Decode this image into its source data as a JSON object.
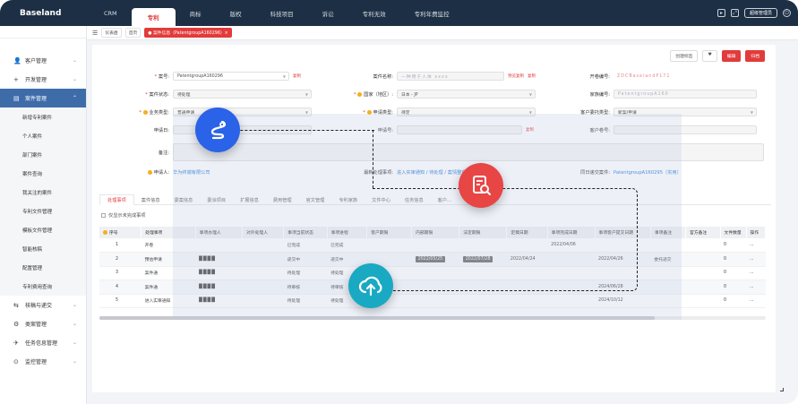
{
  "app": {
    "logo": "Baseland"
  },
  "topnav": {
    "tabs": [
      "CRM",
      "专利",
      "商标",
      "版权",
      "科技项目",
      "诉讼",
      "专利无效",
      "专利年费监控"
    ],
    "active": "专利",
    "user_label": "超级管理员"
  },
  "breadcrumb": {
    "toggle": "☰",
    "items": [
      "仪表盘",
      "首页"
    ],
    "current": "● 案件信息（PatentgroupA160296）×"
  },
  "sidebar": {
    "items": [
      {
        "icon": "👤",
        "label": "客户管理"
      },
      {
        "icon": "+",
        "label": "开发管理"
      },
      {
        "icon": "▤",
        "label": "案件管理"
      }
    ],
    "subitems": [
      "新增专利案件",
      "个人案件",
      "部门案件",
      "案件查询",
      "我关注的案件",
      "专利文件管理",
      "模板文件管理",
      "智能核稿",
      "配置管理",
      "专利费用查询"
    ],
    "bottom_items": [
      {
        "icon": "⇆",
        "label": "核稿与递交"
      },
      {
        "icon": "⚙",
        "label": "类案管理"
      },
      {
        "icon": "✈",
        "label": "任务信息管理"
      },
      {
        "icon": "⊙",
        "label": "监控管理"
      }
    ]
  },
  "actions": {
    "a1": "创建标签",
    "a2": "♥",
    "a3": "编辑",
    "a4": "归档"
  },
  "form": {
    "case_no_label": "案号:",
    "case_no": "PatentgroupA160296",
    "case_no_extra": "复制",
    "case_name_label": "案件名称:",
    "case_name": "一种用于人体 xxxx",
    "case_name_link": "预览复制",
    "case_name_copy": "复制",
    "open_no_label": "开卷编号:",
    "open_no": "ZDCBaselandP171",
    "status_label": "案件状态:",
    "status": "待处理",
    "country_label": "国家（地区）:",
    "country": "日本 - JP",
    "family_no_label": "家族编号:",
    "family_no": "PatentgroupA160",
    "biz_type_label": "业务类型:",
    "biz_type": "普通申请",
    "app_type_label": "申请类型:",
    "app_type": "待定",
    "client_type_label": "客户委托类型:",
    "client_type": "新案/申请",
    "app_date_label": "申请日:",
    "app_no_label": "申请号:",
    "app_no_link": "复制",
    "client_no_label": "客户卷号:",
    "note_label": "备注:",
    "applicant_label": "申请人:",
    "applicant": "华为终端有限公司",
    "latest_label": "最新处理事项:",
    "latest": "进入实审通知 / 待处理 / 案情整理报告",
    "same_case_label": "同日递交案件:",
    "same_case": "PatentgroupA160295（实用）"
  },
  "subtabs": [
    "处理事项",
    "案件信息",
    "委案信息",
    "委派项目",
    "扩展信息",
    "费用管理",
    "官文管理",
    "专利家族",
    "文件中心",
    "任务信息",
    "客户..."
  ],
  "checkbox_label": "仅显示未完成事项",
  "table": {
    "headers": [
      "序号",
      "处理事项",
      "事项办理人",
      "对外处理人",
      "事项当前状态",
      "事项进程",
      "客户期限",
      "内部期限",
      "法定期限",
      "定稿日期",
      "事项完成日期",
      "事项客户提交日期",
      "事项备注",
      "官方备注",
      "文件数量",
      "操作"
    ],
    "rows": [
      {
        "no": "1",
        "item": "开卷",
        "handler": "",
        "ext": "",
        "status": "已完成",
        "progress": "已完成",
        "client_dl": "",
        "internal_dl": "",
        "legal_dl": "",
        "final_date": "",
        "done_date": "2022/04/06",
        "submit_date": "",
        "note": "",
        "official": "",
        "files": "0",
        "op": "..."
      },
      {
        "no": "2",
        "item": "预估申请",
        "handler": "",
        "ext": "",
        "status": "递交中",
        "progress": "递交中",
        "client_dl": "",
        "internal_dl": "2022/05/25",
        "legal_dl": "2022/07/28",
        "final_date": "2022/04/24",
        "done_date": "",
        "submit_date": "2022/04/26",
        "note": "委托递交",
        "official": "",
        "files": "0",
        "op": "..."
      },
      {
        "no": "3",
        "item": "案件通",
        "handler": "",
        "ext": "",
        "status": "待处理",
        "progress": "待处理",
        "client_dl": "",
        "internal_dl": "",
        "legal_dl": "",
        "final_date": "",
        "done_date": "",
        "submit_date": "",
        "note": "",
        "official": "",
        "files": "0",
        "op": "..."
      },
      {
        "no": "4",
        "item": "案件通",
        "handler": "",
        "ext": "",
        "status": "待审核",
        "progress": "待审核",
        "client_dl": "",
        "internal_dl": "",
        "legal_dl": "",
        "final_date": "",
        "done_date": "",
        "submit_date": "2024/06/28",
        "note": "",
        "official": "",
        "files": "0",
        "op": "..."
      },
      {
        "no": "5",
        "item": "进入实审通知",
        "handler": "",
        "ext": "",
        "status": "待处理",
        "progress": "待处理",
        "client_dl": "",
        "internal_dl": "",
        "legal_dl": "",
        "final_date": "",
        "done_date": "",
        "submit_date": "2024/10/12",
        "note": "",
        "official": "",
        "files": "0",
        "op": "..."
      }
    ]
  },
  "colors": {
    "topbar": "#1d2f44",
    "accent": "#e23b3b",
    "sidebar_active": "#3e6ca8",
    "bubble_blue": "#2a63e8",
    "bubble_red": "#e84545",
    "bubble_teal": "#1aa9c2"
  },
  "icons": {
    "bubble1": "route-icon",
    "bubble2": "document-search-icon",
    "bubble3": "cloud-upload-icon"
  }
}
